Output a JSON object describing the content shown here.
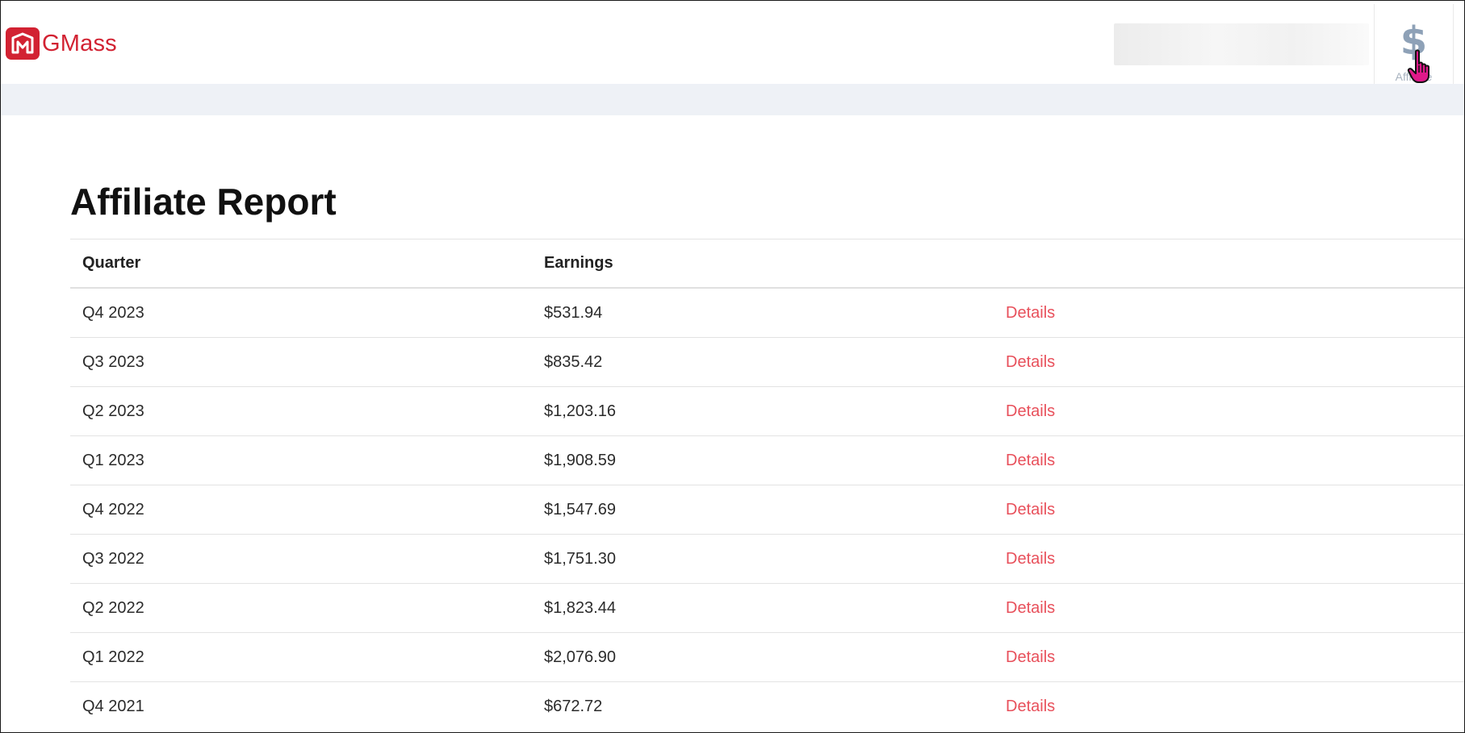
{
  "brand": {
    "name": "GMass",
    "color": "#d22232"
  },
  "header": {
    "affiliate_nav": {
      "icon": "dollar-icon",
      "label": "Affiliate"
    }
  },
  "page": {
    "title": "Affiliate Report"
  },
  "table": {
    "columns": [
      "Quarter",
      "Earnings",
      ""
    ],
    "rows": [
      {
        "quarter": "Q4 2023",
        "earnings": "$531.94",
        "action": "Details"
      },
      {
        "quarter": "Q3 2023",
        "earnings": "$835.42",
        "action": "Details"
      },
      {
        "quarter": "Q2 2023",
        "earnings": "$1,203.16",
        "action": "Details"
      },
      {
        "quarter": "Q1 2023",
        "earnings": "$1,908.59",
        "action": "Details"
      },
      {
        "quarter": "Q4 2022",
        "earnings": "$1,547.69",
        "action": "Details"
      },
      {
        "quarter": "Q3 2022",
        "earnings": "$1,751.30",
        "action": "Details"
      },
      {
        "quarter": "Q2 2022",
        "earnings": "$1,823.44",
        "action": "Details"
      },
      {
        "quarter": "Q1 2022",
        "earnings": "$2,076.90",
        "action": "Details"
      },
      {
        "quarter": "Q4 2021",
        "earnings": "$672.72",
        "action": "Details"
      }
    ]
  },
  "colors": {
    "link": "#e8505b",
    "subbar": "#eef1f6",
    "nav_icon": "#8ea1b7"
  }
}
